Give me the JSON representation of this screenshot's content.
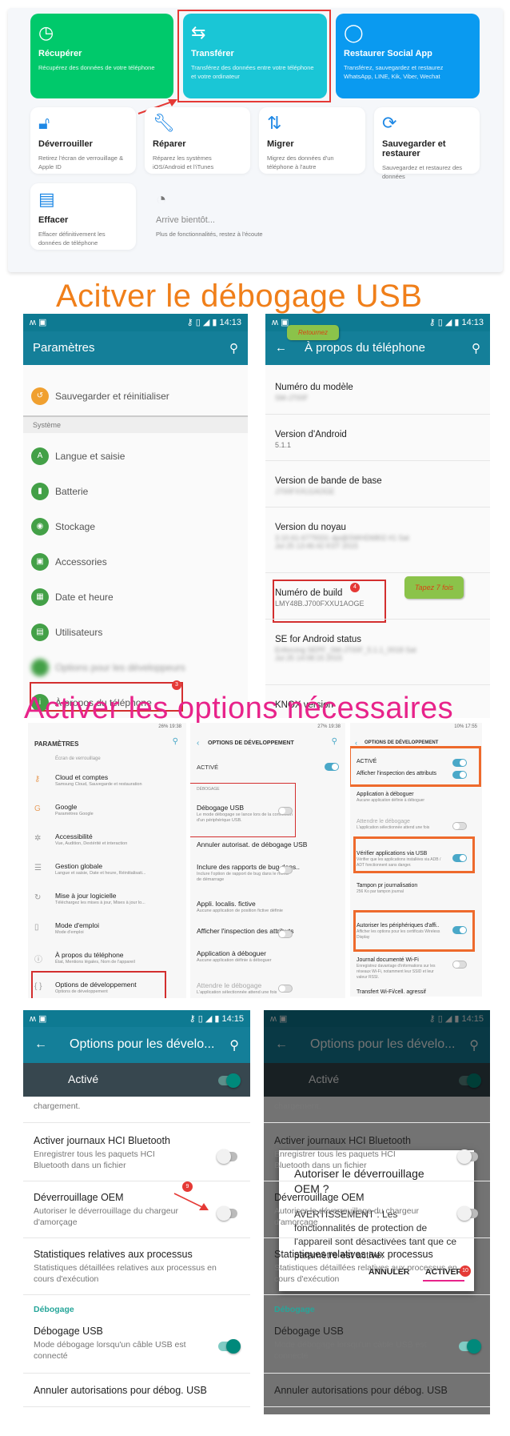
{
  "top_panel": {
    "cards": [
      {
        "icon": "history-icon",
        "title": "Récupérer",
        "desc": "Récupérez des données de votre téléphone",
        "color": "#00c96b"
      },
      {
        "icon": "transfer-icon",
        "title": "Transférer",
        "desc": "Transférez des données entre votre téléphone et votre ordinateur",
        "color": "#1ac6d6"
      },
      {
        "icon": "chat-icon",
        "title": "Restaurer Social App",
        "desc": "Transférez, sauvegardez et restaurez WhatsApp, LINE, Kik, Viber, Wechat",
        "color": "#0a9af0"
      },
      {
        "icon": "unlock-icon",
        "title": "Déverrouiller",
        "desc": "Retirez l'écran de verrouillage & Apple ID"
      },
      {
        "icon": "wrench-icon",
        "title": "Réparer",
        "desc": "Réparez les systèmes iOS/Android et l'iTunes"
      },
      {
        "icon": "migrate-icon",
        "title": "Migrer",
        "desc": "Migrez des données d'un téléphone à l'autre"
      },
      {
        "icon": "sync-icon",
        "title": "Sauvegarder et restaurer",
        "desc": "Sauvegardez et restaurez des données"
      },
      {
        "icon": "shredder-icon",
        "title": "Effacer",
        "desc": "Effacer définitivement les données de téléphone"
      },
      {
        "icon": "timer-icon",
        "title": "Arrive bientôt...",
        "desc": "Plus de fonctionnalités, restez à l'écoute"
      }
    ]
  },
  "heading1": "Acitver le débogage USB",
  "heading2": "Activer les options  nécessaires",
  "phone1": {
    "time": "14:13",
    "title": "Paramètres",
    "section": "Système",
    "items": [
      "Sauvegarder et réinitialiser",
      "Langue et saisie",
      "Batterie",
      "Stockage",
      "Accessories",
      "Date et heure",
      "Utilisateurs",
      "Options pour les développeurs",
      "À propos du téléphone"
    ],
    "badge": "3"
  },
  "phone2": {
    "time": "14:13",
    "title": "À propos du téléphone",
    "callout_back": "Retournez",
    "callout_tap": "Tapez 7 fois",
    "badge": "4",
    "rows": [
      {
        "title": "Numéro du modèle",
        "value": "SM-J700F"
      },
      {
        "title": "Version d'Android",
        "value": "5.1.1"
      },
      {
        "title": "Version de bande de base",
        "value": "J700FXXU1AOGE"
      },
      {
        "title": "Version du noyau",
        "value": "3.10.61-6779331 dpi@SWHD6802 #1 Sat Jul 25 13:46:42 KST 2015"
      },
      {
        "title": "Numéro de build",
        "value": "LMY48B.J700FXXU1AOGE"
      },
      {
        "title": "SE for Android status",
        "value": "Enforcing SEPF_SM-J700F_5.1.1_0018 Sat Jul 25 14:08:15 2015"
      },
      {
        "title": "KNOX version",
        "value": ""
      }
    ]
  },
  "samsung1": {
    "status": "26% 19:38",
    "title": "PARAMÈTRES",
    "top_item": "Écran de verrouillage",
    "items": [
      {
        "t": "Cloud et comptes",
        "s": "Samsung Cloud, Sauvegarde et restauration"
      },
      {
        "t": "Google",
        "s": "Paramètres Google"
      },
      {
        "t": "Accessibilité",
        "s": "Vue, Audition, Dextérité et interaction"
      },
      {
        "t": "Gestion globale",
        "s": "Langue et saisie, Date et heure, Réinitialisati..."
      },
      {
        "t": "Mise à jour logicielle",
        "s": "Téléchargez les mises à jour, Mises à jour lo..."
      },
      {
        "t": "Mode d'emploi",
        "s": "Mode d'emploi"
      },
      {
        "t": "À propos du téléphone",
        "s": "État, Mentions légales, Nom de l'appareil"
      },
      {
        "t": "Options de développement",
        "s": "Options de développement"
      }
    ]
  },
  "samsung2": {
    "status": "27% 19:38",
    "title": "OPTIONS DE DÉVELOPPEMENT",
    "active": "ACTIVÉ",
    "section": "DÉBOGAGE",
    "items": [
      {
        "t": "Débogage USB",
        "s": "Le mode débogage se lance lors de la connexion d'un périphérique USB.",
        "toggle": false
      },
      {
        "t": "Annuler autorisat. de débogage USB",
        "s": ""
      },
      {
        "t": "Inclure des rapports de bug dans..",
        "s": "Inclure l'option de rapport de bug dans le menu de démarrage",
        "toggle": false
      },
      {
        "t": "Appli. localis. fictive",
        "s": "Aucune application de position fictive définie"
      },
      {
        "t": "Afficher l'inspection des attributs",
        "s": "",
        "toggle": false
      },
      {
        "t": "Application à déboguer",
        "s": "Aucune application définie à déboguer"
      },
      {
        "t": "Attendre le débogage",
        "s": "L'application sélectionnée attend une fois",
        "toggle": false
      }
    ]
  },
  "samsung3": {
    "status": "10% 17:55",
    "title": "OPTIONS DE DÉVELOPPEMENT",
    "items": [
      {
        "t": "ACTIVÉ",
        "s": "",
        "toggle": true
      },
      {
        "t": "Afficher l'inspection des attributs",
        "s": "",
        "toggle": true
      },
      {
        "t": "Application à déboguer",
        "s": "Aucune application définie à déboguer"
      },
      {
        "t": "Attendre le débogage",
        "s": "L'application sélectionnée attend une fois",
        "toggle": false
      },
      {
        "t": "Vérifier applications via USB",
        "s": "Vérifier que les applications installées via ADB / ADT fonctionnent sans danger.",
        "toggle": true
      },
      {
        "t": "Tampon pr journalisation",
        "s": "256 Ko par tampon journal"
      },
      {
        "t": "Autoriser les périphériques d'affi..",
        "s": "Afficher les options pour les certificats Wireless Display",
        "toggle": true
      },
      {
        "t": "Journal documenté Wi-Fi",
        "s": "Enregistrez davantage d'informations sur les réseaux Wi-Fi, notamment leur SSID et leur valeur RSSI.",
        "toggle": false
      },
      {
        "t": "Transfert Wi-Fi/cell. agressif",
        "s": ""
      }
    ]
  },
  "phone3": {
    "time": "14:15",
    "title": "Options pour les dévelo...",
    "active": "Activé",
    "partial": "chargement.",
    "rows": [
      {
        "t": "Activer journaux HCI Bluetooth",
        "s": "Enregistrer tous les paquets HCI Bluetooth dans un fichier",
        "toggle": false
      },
      {
        "t": "Déverrouillage OEM",
        "s": "Autoriser le déverrouillage du chargeur d'amorçage",
        "toggle": false
      },
      {
        "t": "Statistiques relatives aux processus",
        "s": "Statistiques détaillées relatives aux processus en cours d'exécution"
      }
    ],
    "section": "Débogage",
    "usb": {
      "t": "Débogage USB",
      "s": "Mode débogage lorsqu'un câble USB est connecté",
      "toggle": true
    },
    "revoke": "Annuler autorisations pour débog. USB",
    "badge": "9"
  },
  "dialog": {
    "title": "Autoriser le déverrouillage OEM ?",
    "body": "AVERTISSEMENT : Les fonctionnalités de protection de l'appareil sont désactivées tant que ce paramètre est activé.",
    "cancel": "ANNULER",
    "confirm": "ACTIVER",
    "badge": "10"
  },
  "colors": {
    "heading1": "#f07f1a",
    "heading2": "#e8238a",
    "toolbar": "#147f99",
    "highlight_red": "#d32f2f",
    "highlight_orange": "#ee6a2c"
  }
}
